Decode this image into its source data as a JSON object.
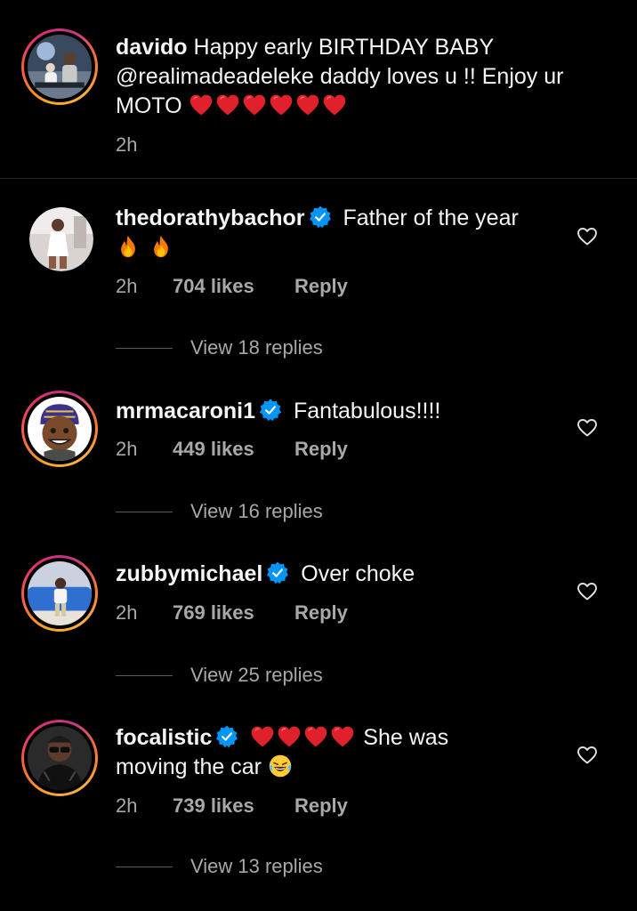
{
  "caption": {
    "username": "davido",
    "text_part1": "Happy early BIRTHDAY BABY",
    "mention": "@realimadeadeleke",
    "text_part2": "daddy loves u !! Enjoy ur MOTO",
    "emojis": [
      "red-heart",
      "red-heart",
      "red-heart",
      "red-heart",
      "red-heart",
      "red-heart"
    ],
    "time": "2h"
  },
  "comments": [
    {
      "username": "thedorathybachor",
      "verified": true,
      "text": "Father of the year",
      "emojis_after": [
        "fire",
        "fire"
      ],
      "time": "2h",
      "likes": "704 likes",
      "reply": "Reply",
      "view_replies": "View 18 replies"
    },
    {
      "username": "mrmacaroni1",
      "verified": true,
      "text": "Fantabulous!!!!",
      "time": "2h",
      "likes": "449 likes",
      "reply": "Reply",
      "view_replies": "View 16 replies"
    },
    {
      "username": "zubbymichael",
      "verified": true,
      "text": "Over choke",
      "time": "2h",
      "likes": "769 likes",
      "reply": "Reply",
      "view_replies": "View 25 replies"
    },
    {
      "username": "focalistic",
      "verified": true,
      "emojis_before": [
        "red-heart",
        "red-heart",
        "red-heart",
        "red-heart"
      ],
      "text": "She was moving the car",
      "emojis_after": [
        "face-with-tears-of-joy"
      ],
      "time": "2h",
      "likes": "739 likes",
      "reply": "Reply",
      "view_replies": "View 13 replies"
    }
  ],
  "colors": {
    "background": "#000000",
    "text": "#f5f5f5",
    "secondary_text": "#a8a8a8",
    "verified_badge": "#0095f6",
    "heart_emoji": "#e0202b"
  }
}
